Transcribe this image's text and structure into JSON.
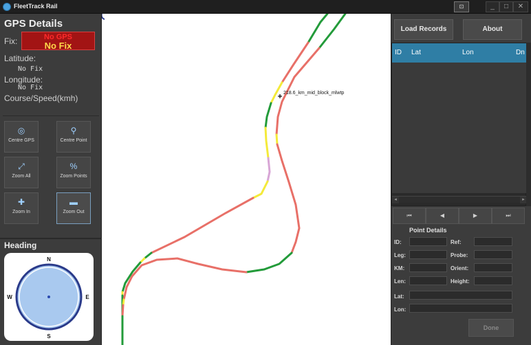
{
  "window": {
    "title": "FleetTrack Rail",
    "min": "_",
    "max": "□",
    "close": "✕",
    "mode": "⊡"
  },
  "gps": {
    "title": "GPS Details",
    "fix_label": "Fix:",
    "fix_line1": "No GPS",
    "fix_line2": "No Fix",
    "latitude_label": "Latitude:",
    "latitude_value": "No Fix",
    "longitude_label": "Longitude:",
    "longitude_value": "No Fix",
    "course_label": "Course/Speed(kmh)"
  },
  "tools": [
    {
      "label": "Centre GPS",
      "icon": "crosshair-icon",
      "glyph": "◎"
    },
    {
      "label": "Centre Point",
      "icon": "location-pin-icon",
      "glyph": "⚲"
    },
    {
      "label": "Zoom All",
      "icon": "zoom-all-icon",
      "glyph": "⤢"
    },
    {
      "label": "Zoom Points",
      "icon": "zoom-points-icon",
      "glyph": "%"
    },
    {
      "label": "Zoom In",
      "icon": "plus-icon",
      "glyph": "✚"
    },
    {
      "label": "Zoom Out",
      "icon": "minus-icon",
      "glyph": "▬"
    }
  ],
  "heading": {
    "title": "Heading",
    "n": "N",
    "s": "S",
    "e": "E",
    "w": "W"
  },
  "map": {
    "marker_label": "218.6_km_mid_block_mlwtp",
    "colors": {
      "green": "#239b3a",
      "red": "#e87068",
      "yellow": "#f4ea3a",
      "lilac": "#d8a6d6"
    }
  },
  "records": {
    "load_button": "Load Records",
    "about_button": "About",
    "columns": [
      "ID",
      "Lat",
      "Lon",
      "Dn"
    ],
    "nav": [
      "⏮",
      "◀",
      "▶",
      "⏭"
    ]
  },
  "point_details": {
    "title": "Point Details",
    "id_label": "ID:",
    "ref_label": "Ref:",
    "leg_label": "Leg:",
    "probe_label": "Probe:",
    "km_label": "KM:",
    "orient_label": "Orient:",
    "len_label": "Len:",
    "height_label": "Height:",
    "lat_label": "Lat:",
    "lon_label": "Lon:",
    "done_button": "Done"
  },
  "colors": {
    "accent": "#2f7ea5",
    "fix_bg": "#a21414",
    "fix_text1": "#ff2a2a",
    "fix_text2": "#ffd84a"
  }
}
